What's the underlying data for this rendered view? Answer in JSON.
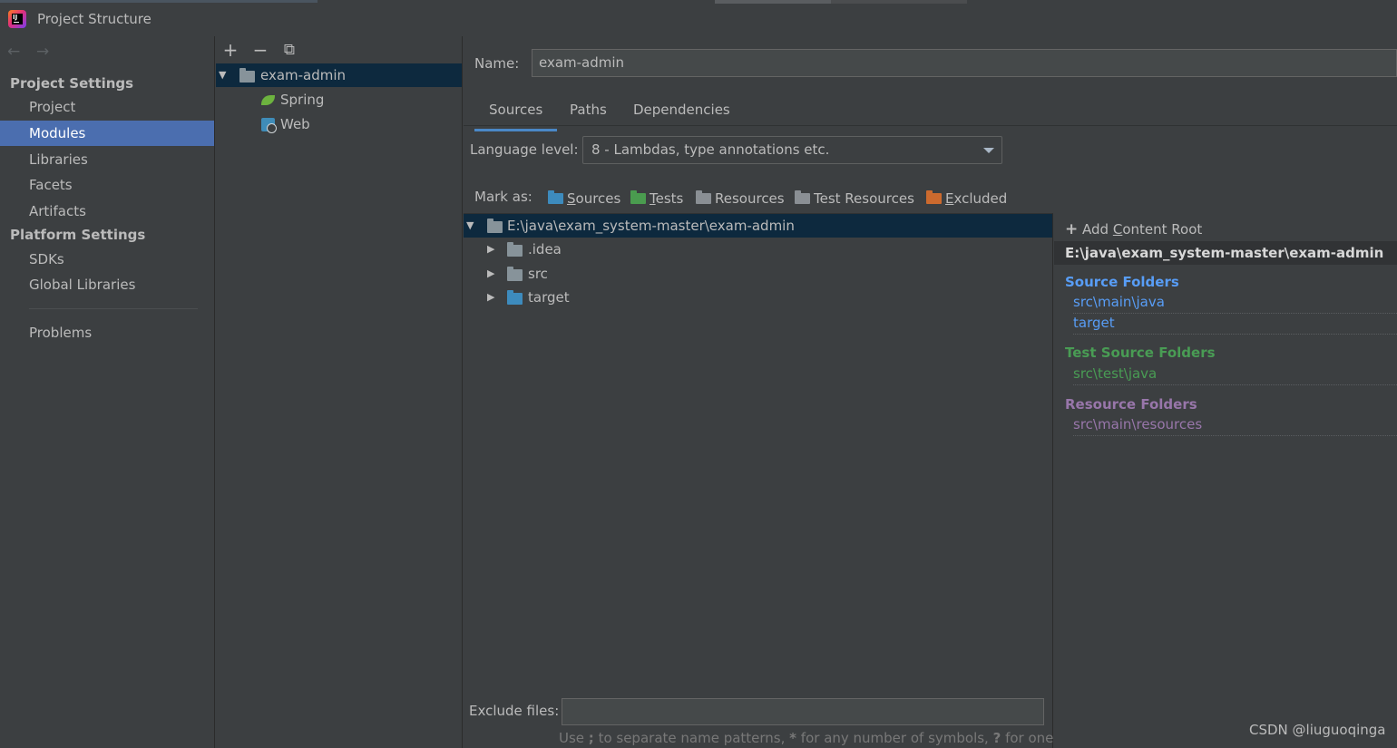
{
  "window": {
    "title": "Project Structure"
  },
  "nav": {
    "back": "←",
    "forward": "→"
  },
  "sidebar": {
    "project_settings_header": "Project Settings",
    "project_settings_items": [
      "Project",
      "Modules",
      "Libraries",
      "Facets",
      "Artifacts"
    ],
    "selected": "Modules",
    "platform_settings_header": "Platform Settings",
    "platform_settings_items": [
      "SDKs",
      "Global Libraries"
    ],
    "problems": "Problems"
  },
  "module_toolbar": {
    "add": "+",
    "remove": "−",
    "copy": "⧉"
  },
  "module_tree": {
    "root": "exam-admin",
    "children": [
      "Spring",
      "Web"
    ]
  },
  "details": {
    "name_label": "Name:",
    "name_value": "exam-admin",
    "tabs": [
      "Sources",
      "Paths",
      "Dependencies"
    ],
    "active_tab": "Sources",
    "language_level_label": "Language level:",
    "language_level_value": "8 - Lambdas, type annotations etc.",
    "mark_as_label": "Mark as:",
    "mark_as": [
      {
        "prefix": "",
        "key": "S",
        "rest": "ources",
        "color": "#3d8bbd"
      },
      {
        "prefix": "",
        "key": "T",
        "rest": "ests",
        "color": "#4a9c4f"
      },
      {
        "prefix": "Resources",
        "key": "",
        "rest": "",
        "color": "#8a8f94"
      },
      {
        "prefix": "Test Resources",
        "key": "",
        "rest": "",
        "color": "#8a8f94"
      },
      {
        "prefix": "",
        "key": "E",
        "rest": "xcluded",
        "color": "#cc6a2e"
      }
    ],
    "content_tree": {
      "root": "E:\\java\\exam_system-master\\exam-admin",
      "children": [
        {
          "name": ".idea",
          "color": "#87939a"
        },
        {
          "name": "src",
          "color": "#87939a"
        },
        {
          "name": "target",
          "color": "#3d8bbd"
        }
      ]
    },
    "exclude_label": "Exclude files:",
    "exclude_value": "",
    "exclude_hint_parts": [
      "Use ",
      ";",
      " to separate name patterns, ",
      "*",
      " for any number of symbols, ",
      "?",
      " for one."
    ]
  },
  "content_roots": {
    "add_label_prefix": "Add ",
    "add_label_key": "C",
    "add_label_rest": "ontent Root",
    "root_path": "E:\\java\\exam_system-master\\exam-admin",
    "source_header": "Source Folders",
    "source_items": [
      "src\\main\\java",
      "target"
    ],
    "test_header": "Test Source Folders",
    "test_items": [
      "src\\test\\java"
    ],
    "resource_header": "Resource Folders",
    "resource_items": [
      "src\\main\\resources"
    ]
  },
  "watermark": "CSDN @liuguoqinga",
  "colors": {
    "selection": "#4b6eaf",
    "tree_selection": "#0d293e",
    "source": "#589df6",
    "test": "#499c54",
    "resource": "#9876aa"
  }
}
